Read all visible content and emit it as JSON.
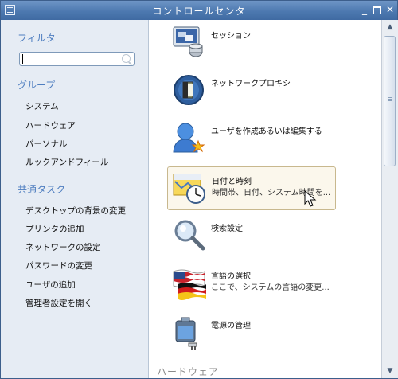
{
  "window": {
    "title": "コントロールセンタ",
    "icon": "app-menu-icon",
    "controls": {
      "minimize": "_",
      "close": "✕"
    }
  },
  "sidebar": {
    "filter_heading": "フィルタ",
    "search": {
      "value": "",
      "placeholder": ""
    },
    "groups_heading": "グループ",
    "groups": [
      {
        "label": "システム"
      },
      {
        "label": "ハードウェア"
      },
      {
        "label": "パーソナル"
      },
      {
        "label": "ルックアンドフィール"
      }
    ],
    "tasks_heading": "共通タスク",
    "tasks": [
      {
        "label": "デスクトップの背景の変更"
      },
      {
        "label": "プリンタの追加"
      },
      {
        "label": "ネットワークの設定"
      },
      {
        "label": "パスワードの変更"
      },
      {
        "label": "ユーザの追加"
      },
      {
        "label": "管理者設定を開く"
      }
    ]
  },
  "modules": [
    {
      "title": "セッション",
      "subtitle": "",
      "icon": "session-icon"
    },
    {
      "title": "ネットワークプロキシ",
      "subtitle": "",
      "icon": "network-proxy-icon"
    },
    {
      "title": "ユーザを作成あるいは編集する",
      "subtitle": "",
      "icon": "user-icon"
    },
    {
      "title": "日付と時刻",
      "subtitle": "時間帯、日付、システム時間を...",
      "icon": "date-time-icon",
      "selected": true
    },
    {
      "title": "検索設定",
      "subtitle": "",
      "icon": "search-settings-icon"
    },
    {
      "title": "言語の選択",
      "subtitle": "ここで、システムの言語の変更...",
      "icon": "language-flags-icon"
    },
    {
      "title": "電源の管理",
      "subtitle": "",
      "icon": "power-management-icon"
    }
  ],
  "next_group_heading": "ハードウェア",
  "colors": {
    "titlebar": "#4d79b0",
    "sidebar_bg": "#e6ecf4",
    "section_heading": "#4f7ec0",
    "selection_bg": "#fbf7ec"
  }
}
